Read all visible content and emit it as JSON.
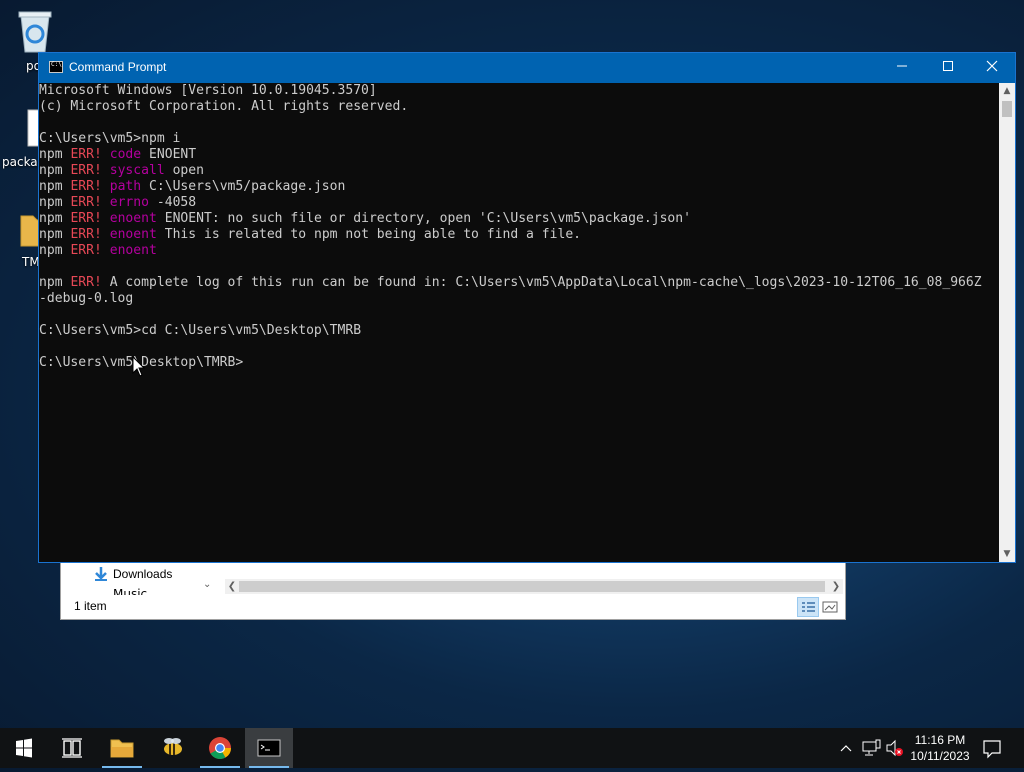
{
  "desktop": {
    "icons": [
      {
        "label": "po",
        "icon": "recycle-bin-icon"
      },
      {
        "label": "packag",
        "icon": "file-icon"
      },
      {
        "label": "TM",
        "icon": "folder-icon"
      }
    ]
  },
  "explorer": {
    "nav_item": "Downloads",
    "nav_item_partial": "Music",
    "status": "1 item"
  },
  "cmd": {
    "title": "Command Prompt",
    "title_bg": "#0063b1",
    "lines": [
      "Microsoft Windows [Version 10.0.19045.3570]",
      "(c) Microsoft Corporation. All rights reserved.",
      "",
      "C:\\Users\\vm5>npm i",
      {
        "npm": "npm",
        "err": "ERR!",
        "key": "code",
        "val": "ENOENT"
      },
      {
        "npm": "npm",
        "err": "ERR!",
        "key": "syscall",
        "val": "open"
      },
      {
        "npm": "npm",
        "err": "ERR!",
        "key": "path",
        "val": "C:\\Users\\vm5/package.json"
      },
      {
        "npm": "npm",
        "err": "ERR!",
        "key": "errno",
        "val": "-4058"
      },
      {
        "npm": "npm",
        "err": "ERR!",
        "key": "enoent",
        "val": "ENOENT: no such file or directory, open 'C:\\Users\\vm5\\package.json'"
      },
      {
        "npm": "npm",
        "err": "ERR!",
        "key": "enoent",
        "val": "This is related to npm not being able to find a file."
      },
      {
        "npm": "npm",
        "err": "ERR!",
        "key": "enoent",
        "val": ""
      },
      "",
      {
        "npm": "npm",
        "err": "ERR!",
        "key": "",
        "val": "A complete log of this run can be found in: C:\\Users\\vm5\\AppData\\Local\\npm-cache\\_logs\\2023-10-12T06_16_08_966Z"
      },
      "-debug-0.log",
      "",
      "C:\\Users\\vm5>cd C:\\Users\\vm5\\Desktop\\TMRB",
      "",
      "C:\\Users\\vm5\\Desktop\\TMRB>"
    ],
    "colors": {
      "err": "#e74856",
      "key": "#b4009e",
      "text": "#cccccc",
      "bg": "#0c0c0c"
    }
  },
  "taskbar": {
    "apps": [
      {
        "name": "start",
        "icon": "windows-logo-icon"
      },
      {
        "name": "task-view",
        "icon": "task-view-icon"
      },
      {
        "name": "file-explorer",
        "icon": "folder-icon"
      },
      {
        "name": "app",
        "icon": "bee-icon"
      },
      {
        "name": "chrome",
        "icon": "chrome-icon"
      },
      {
        "name": "command-prompt",
        "icon": "terminal-icon"
      }
    ],
    "time": "11:16 PM",
    "date": "10/11/2023"
  }
}
